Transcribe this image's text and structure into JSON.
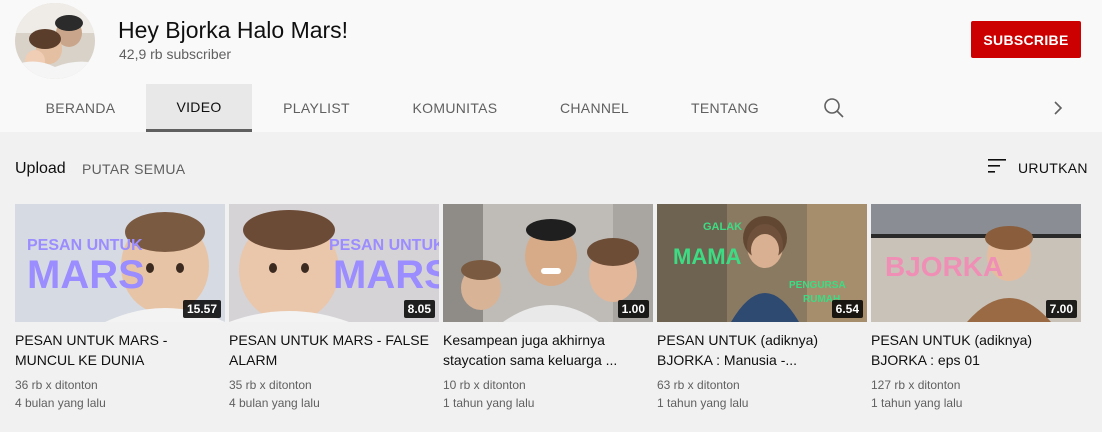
{
  "channel": {
    "name": "Hey Bjorka Halo Mars!",
    "subscribers": "42,9 rb subscriber",
    "subscribe_label": "SUBSCRIBE"
  },
  "tabs": [
    {
      "label": "BERANDA",
      "active": false
    },
    {
      "label": "VIDEO",
      "active": true
    },
    {
      "label": "PLAYLIST",
      "active": false
    },
    {
      "label": "KOMUNITAS",
      "active": false
    },
    {
      "label": "CHANNEL",
      "active": false
    },
    {
      "label": "TENTANG",
      "active": false
    }
  ],
  "section": {
    "upload_label": "Upload",
    "play_all_label": "PUTAR SEMUA",
    "sort_label": "URUTKAN"
  },
  "videos": [
    {
      "title": "PESAN UNTUK MARS - MUNCUL KE DUNIA",
      "duration": "15.57",
      "views": "36 rb x ditonton",
      "age": "4 bulan yang lalu",
      "overlay_line1": "PESAN UNTUK",
      "overlay_line2": "MARS"
    },
    {
      "title": "PESAN UNTUK MARS - FALSE ALARM",
      "duration": "8.05",
      "views": "35 rb x ditonton",
      "age": "4 bulan yang lalu",
      "overlay_line1": "PESAN UNTUK",
      "overlay_line2": "MARS"
    },
    {
      "title": "Kesampean juga akhirnya staycation sama keluarga ...",
      "duration": "1.00",
      "views": "10 rb x ditonton",
      "age": "1 tahun yang lalu"
    },
    {
      "title": "PESAN UNTUK (adiknya) BJORKA : Manusia -...",
      "duration": "6.54",
      "views": "63 rb x ditonton",
      "age": "1 tahun yang lalu",
      "overlay_a": "GALAK",
      "overlay_b": "MAMA",
      "overlay_c": "PENGURSA",
      "overlay_d": "RUMAH"
    },
    {
      "title": "PESAN UNTUK (adiknya) BJORKA : eps 01",
      "duration": "7.00",
      "views": "127 rb x ditonton",
      "age": "1 tahun yang lalu",
      "overlay_line1": "BJORKA"
    }
  ],
  "colors": {
    "accent": "#cc0000",
    "overlay_purple": "#9b8cff",
    "overlay_green": "#3ddc84",
    "overlay_pink": "#f08fb6"
  }
}
